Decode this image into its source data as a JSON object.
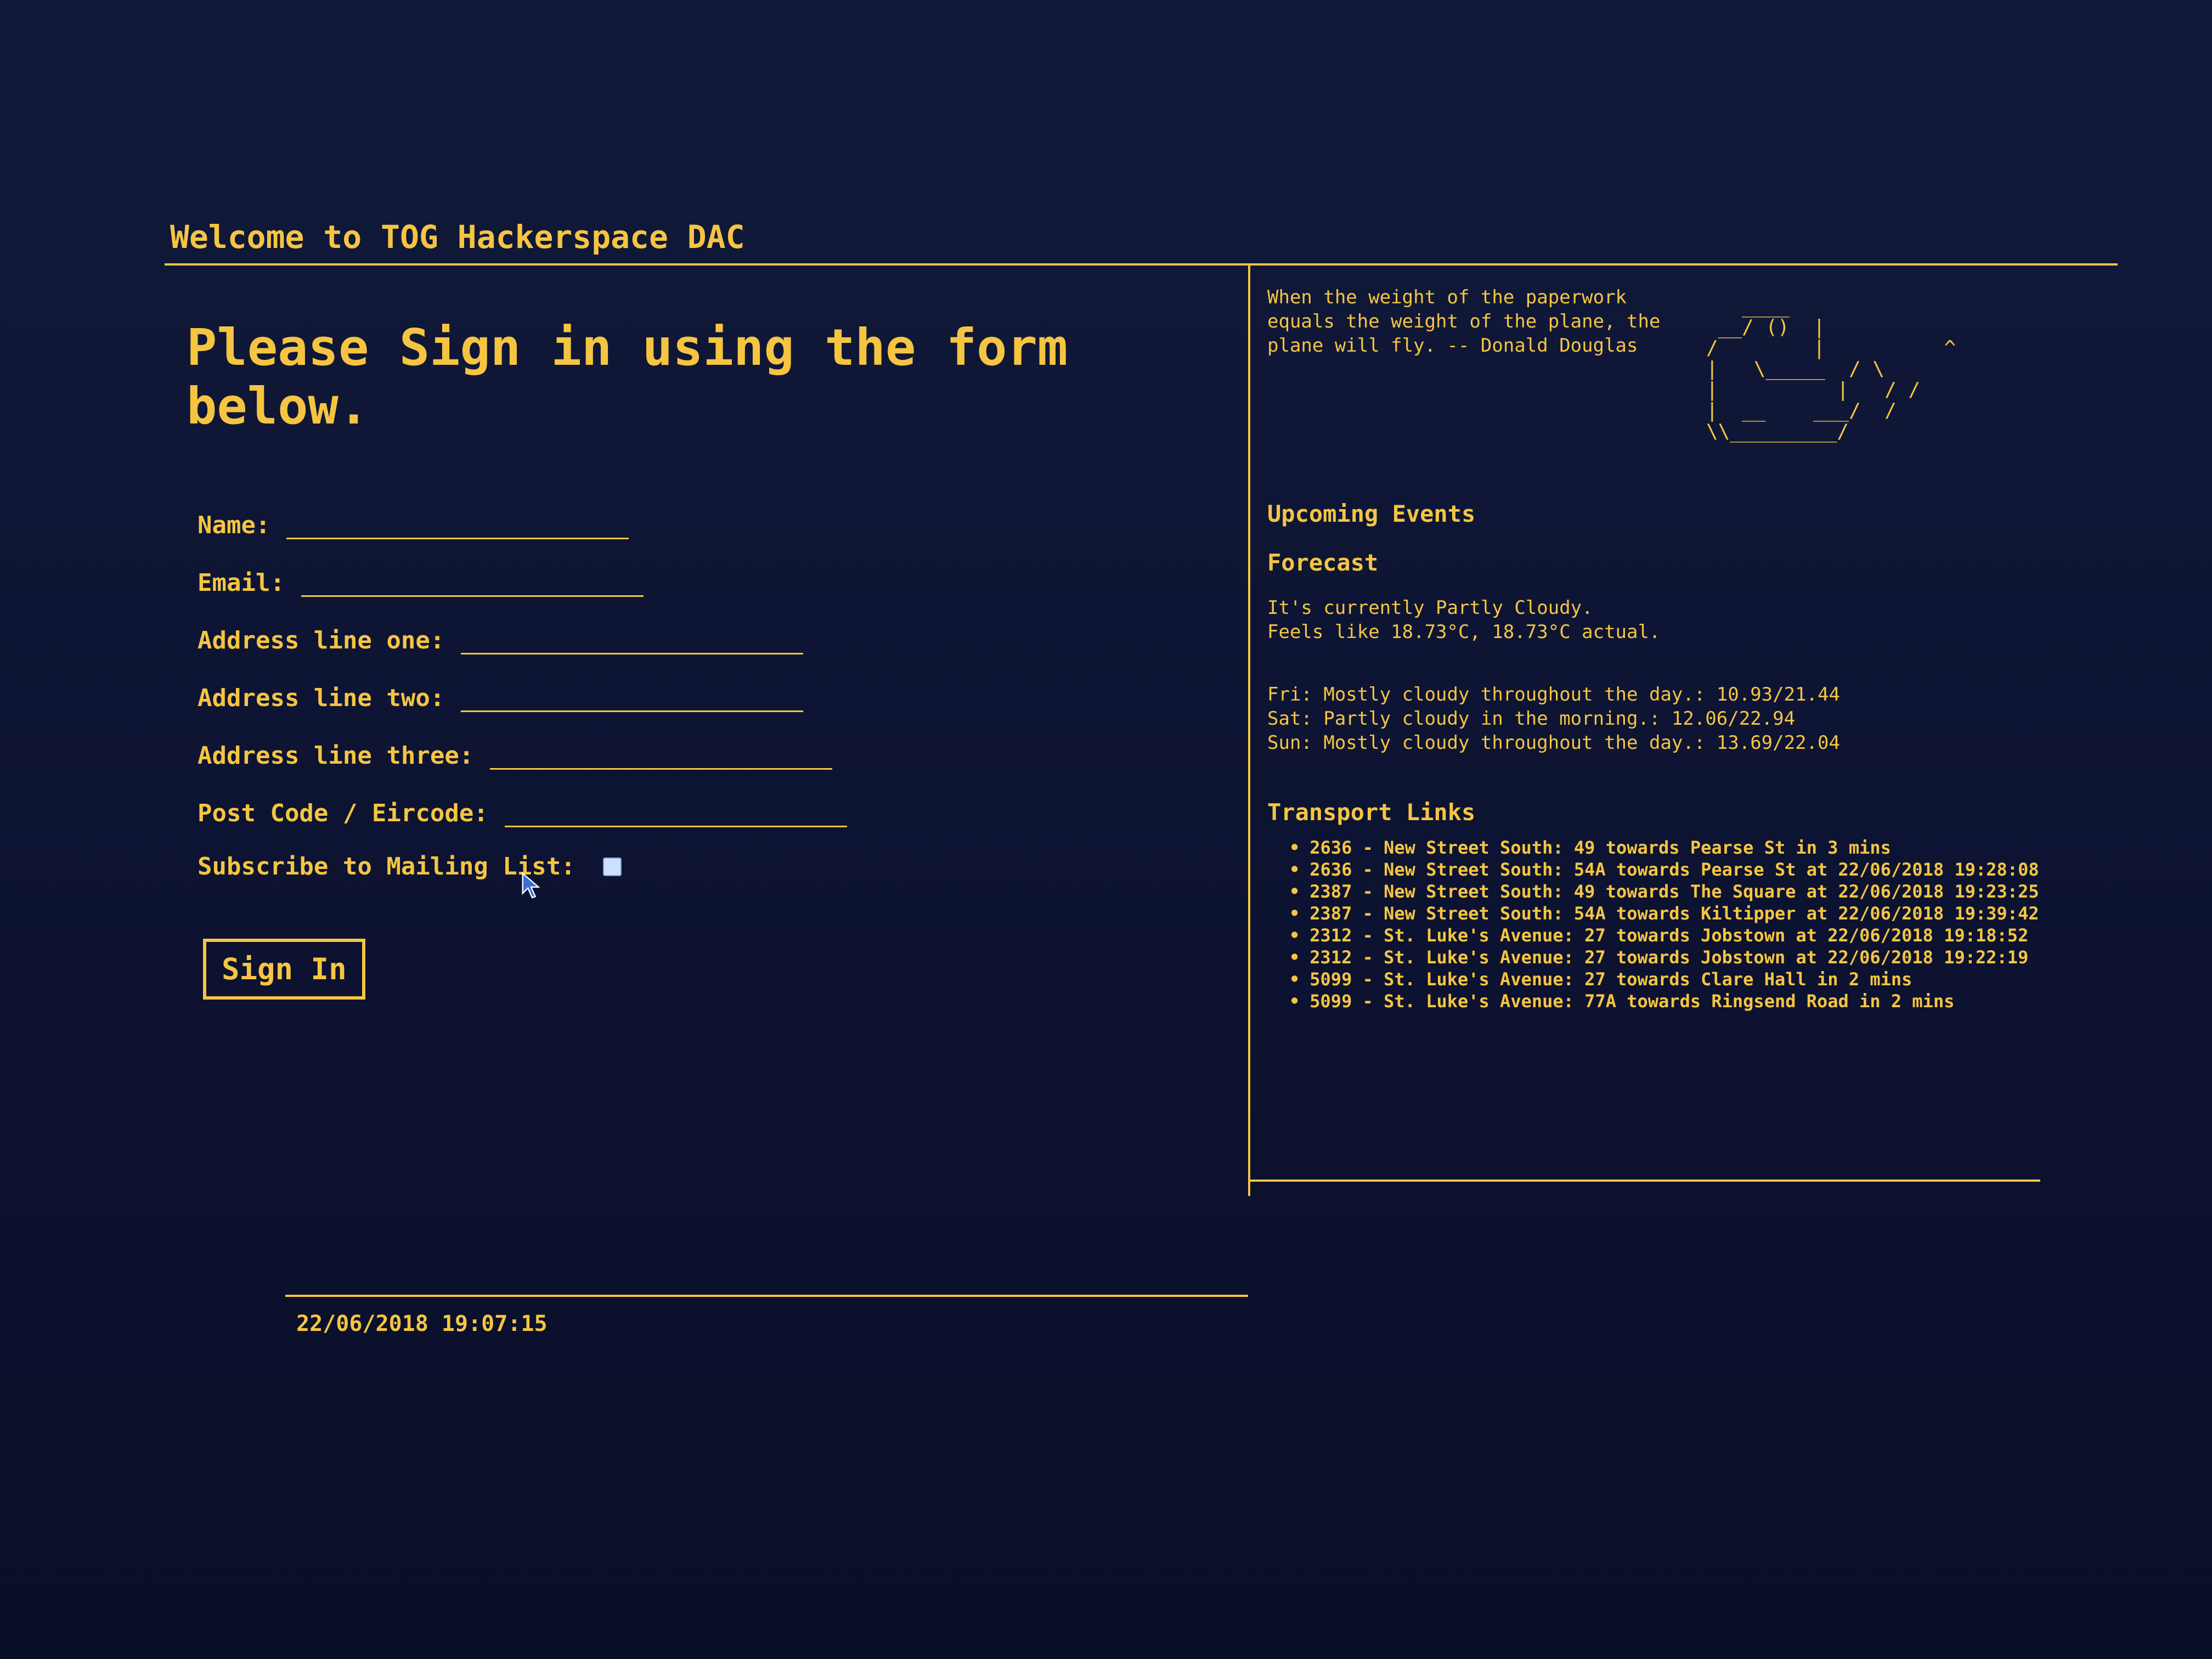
{
  "header": {
    "title": "Welcome to TOG Hackerspace DAC"
  },
  "form": {
    "heading": "Please Sign in using the form below.",
    "fields": [
      {
        "label": "Name:",
        "value": ""
      },
      {
        "label": "Email:",
        "value": ""
      },
      {
        "label": "Address line one:",
        "value": ""
      },
      {
        "label": "Address line two:",
        "value": ""
      },
      {
        "label": "Address line three:",
        "value": ""
      },
      {
        "label": "Post Code / Eircode:",
        "value": ""
      }
    ],
    "subscribe_label": "Subscribe to Mailing List:",
    "subscribe_checked": false,
    "submit_label": "Sign In"
  },
  "sidebar": {
    "quote": "When the weight of the paperwork\nequals the weight of the plane, the\nplane will fly. -- Donald Douglas",
    "duck_art": "   ____\n __/ ()  |\n/        |          ^\n|   \\_____  / \\\n|          |   / /\n|  __    ___/  /\n\\\\_________/",
    "events_title": "Upcoming Events",
    "forecast_title": "Forecast",
    "forecast_now": "It's currently Partly Cloudy.\nFeels like 18.73°C, 18.73°C actual.",
    "forecast_days": [
      "Fri: Mostly cloudy throughout the day.: 10.93/21.44",
      "Sat: Partly cloudy in the morning.: 12.06/22.94",
      "Sun: Mostly cloudy throughout the day.: 13.69/22.04"
    ],
    "transport_title": "Transport Links",
    "transport": [
      "2636 - New Street South: 49 towards Pearse St in 3 mins",
      "2636 - New Street South: 54A towards Pearse St at 22/06/2018 19:28:08",
      "2387 - New Street South: 49 towards The Square at 22/06/2018 19:23:25",
      "2387 - New Street South: 54A towards Kiltipper at 22/06/2018 19:39:42",
      "2312 - St. Luke's Avenue: 27 towards Jobstown at 22/06/2018 19:18:52",
      "2312 - St. Luke's Avenue: 27 towards Jobstown at 22/06/2018 19:22:19",
      "5099 - St. Luke's Avenue: 27 towards Clare Hall in 2 mins",
      "5099 - St. Luke's Avenue: 77A towards Ringsend Road in 2 mins"
    ]
  },
  "footer": {
    "timestamp": "22/06/2018 19:07:15"
  }
}
